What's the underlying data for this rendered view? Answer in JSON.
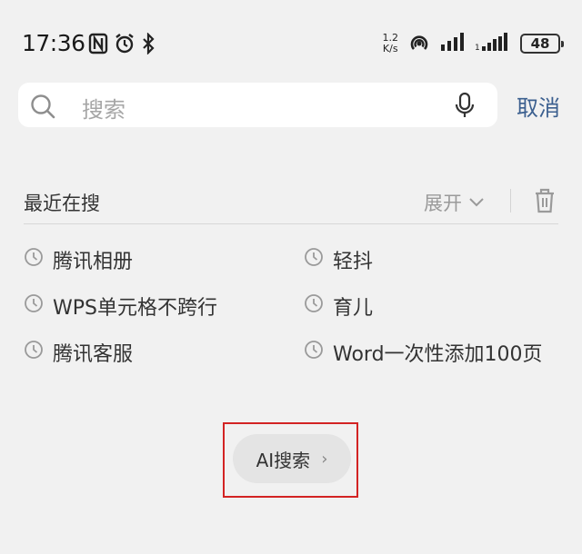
{
  "status_bar": {
    "time": "17:36",
    "net_speed_value": "1.2",
    "net_speed_unit": "K/s",
    "battery": "48",
    "icons": [
      "nfc-icon",
      "alarm-icon",
      "bluetooth-icon",
      "hotspot-icon",
      "signal-icon",
      "signal-2-icon",
      "battery-icon"
    ]
  },
  "search": {
    "placeholder": "搜索",
    "cancel_label": "取消"
  },
  "recent": {
    "title": "最近在搜",
    "expand_label": "展开",
    "items": [
      {
        "label": "腾讯相册"
      },
      {
        "label": "轻抖"
      },
      {
        "label": "WPS单元格不跨行"
      },
      {
        "label": "育儿"
      },
      {
        "label": "腾讯客服"
      },
      {
        "label": "Word一次性添加100页"
      }
    ]
  },
  "ai_search": {
    "label": "AI搜索",
    "arrow": "›"
  },
  "colors": {
    "background": "#f1f1f1",
    "accent": "#3b5f8f",
    "highlight": "#d32323"
  }
}
